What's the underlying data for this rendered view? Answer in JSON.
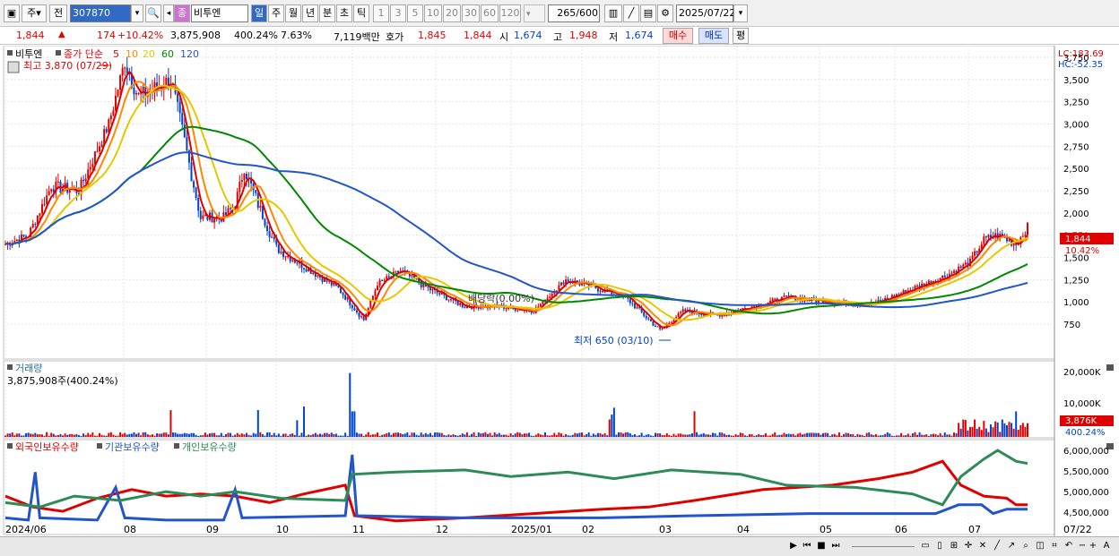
{
  "toolbar": {
    "stock_type": "주",
    "prev_label": "전",
    "stock_code": "307870",
    "stock_name": "비투엔",
    "stock_badge": "종",
    "periods": [
      "일",
      "주",
      "월",
      "년",
      "분",
      "초",
      "틱"
    ],
    "intervals": [
      "1",
      "3",
      "5",
      "10",
      "20",
      "30",
      "60",
      "120"
    ],
    "count_value": "265",
    "count_total": "/600",
    "date_value": "2025/07/22"
  },
  "infobar": {
    "price": "1,844",
    "change_arrow": "▲",
    "change": "174",
    "change_pct": "+10.42%",
    "volume": "3,875,908",
    "volume_pct": "400.24%",
    "turnover": "7.63%",
    "amount": "7,119백만",
    "hoga_label": "호가",
    "hoga_ask": "1,845",
    "hoga_bid": "1,844",
    "open_label": "시",
    "open": "1,674",
    "high_label": "고",
    "high": "1,948",
    "low_label": "저",
    "low": "1,674",
    "buy_label": "매수",
    "sell_label": "매도",
    "eval_label": "평"
  },
  "price_panel": {
    "name": "비투엔",
    "legend_prefix": "종가 단순",
    "ma_labels": [
      "5",
      "10",
      "20",
      "60",
      "120"
    ],
    "ma_colors": [
      "#e00000",
      "#ff8800",
      "#e6c800",
      "#008800",
      "#2255cc"
    ],
    "high_marker": "최고 3,870 (07/29)",
    "low_marker": "최저 650 (03/10)",
    "ex_div_marker": "배당락(0.00%)",
    "lc_label": "LC:183.69",
    "hc_label": "HC:-52.35",
    "current_price_tag": "1,844",
    "current_pct_tag": "10.42%",
    "y_ticks": [
      "3,750",
      "3,500",
      "3,250",
      "3,000",
      "2,750",
      "2,500",
      "2,250",
      "2,000",
      "1,750",
      "1,500",
      "1,250",
      "1,000",
      "750"
    ]
  },
  "volume_panel": {
    "title": "거래량",
    "value_label": "3,875,908주(400.24%)",
    "y_ticks": [
      "20,000K",
      "10,000K"
    ],
    "current_tag": "3,876K",
    "current_pct": "400.24%"
  },
  "holding_panel": {
    "series_labels": [
      "외국인보유수량",
      "기관보유수량",
      "개인보유수량"
    ],
    "series_colors": [
      "#e00000",
      "#2255cc",
      "#2e8b57"
    ],
    "y_ticks": [
      "6,000,000",
      "5,500,000",
      "5,000,000",
      "4,500,000"
    ]
  },
  "x_axis": {
    "labels": [
      "2024/06",
      "08",
      "09",
      "10",
      "11",
      "12",
      "2025/01",
      "02",
      "03",
      "04",
      "05",
      "06",
      "07"
    ],
    "right_label": "07/22"
  },
  "chart_data": {
    "type": "line",
    "price_keypoints": {
      "x": [
        "2024/06",
        "2024/07",
        "2024/07/29",
        "2024/08",
        "2024/09",
        "2024/10",
        "2024/11",
        "2024/12",
        "2025/01",
        "2025/02",
        "2025/03/10",
        "2025/04",
        "2025/05",
        "2025/06",
        "2025/07",
        "2025/07/22"
      ],
      "close": [
        1650,
        2300,
        3870,
        3000,
        1900,
        1350,
        800,
        1150,
        950,
        1250,
        650,
        900,
        1050,
        1000,
        1450,
        1844
      ]
    },
    "ylim": [
      600,
      3850
    ]
  }
}
